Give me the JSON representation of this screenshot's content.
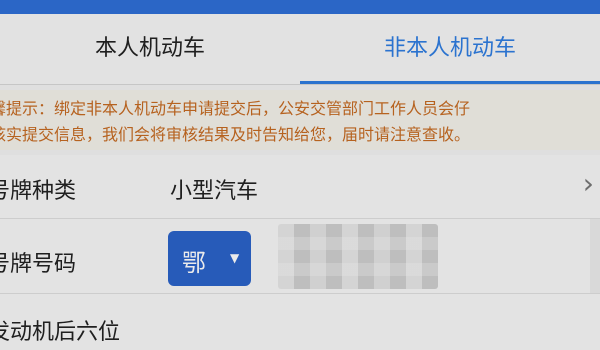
{
  "tabs": {
    "own_vehicle": "本人机动车",
    "other_vehicle": "非本人机动车",
    "active": "other_vehicle"
  },
  "notice": {
    "line1": "馨提示：绑定非本人机动车申请提交后，公安交管部门工作人员会仔",
    "line2": "核实提交信息，我们会将审核结果及时告知给您，届时请注意查收。"
  },
  "form": {
    "plate_type": {
      "label": "号牌种类",
      "value": "小型汽车",
      "chevron": "›"
    },
    "plate_number": {
      "label": "号牌号码",
      "province": "鄂",
      "province_dropdown": "▼"
    },
    "engine_last_six": {
      "label": "发动机后六位"
    }
  },
  "colors": {
    "accent": "#2f7de1",
    "notice_text": "#c66b22",
    "province_button": "#2b63c9"
  }
}
